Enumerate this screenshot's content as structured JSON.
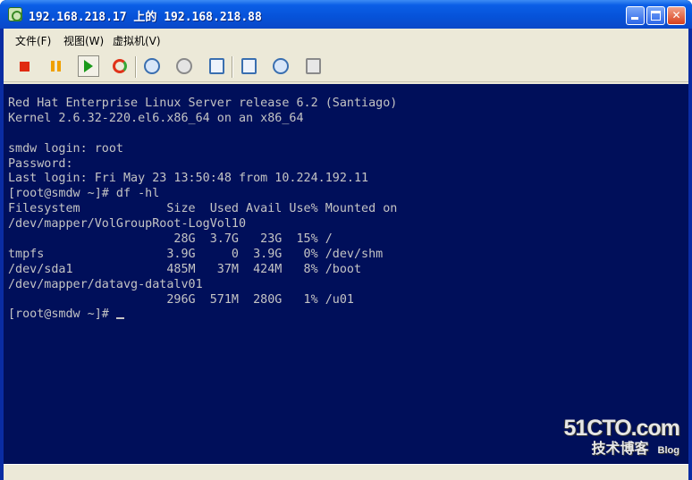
{
  "window": {
    "title": "192.168.218.17 上的 192.168.218.88"
  },
  "menu": {
    "items": [
      "文件(F)",
      "视图(W)",
      "虚拟机(V)"
    ]
  },
  "toolbar": {
    "icons": [
      "stop-icon",
      "pause-icon",
      "play-icon",
      "reset-icon",
      "snapshot-icon",
      "revert-snapshot-icon",
      "snapshot-manager-icon",
      "edit-settings-icon",
      "vm-tools-icon",
      "console-options-icon"
    ]
  },
  "console": {
    "lines": [
      "Red Hat Enterprise Linux Server release 6.2 (Santiago)",
      "Kernel 2.6.32-220.el6.x86_64 on an x86_64",
      "",
      "smdw login: root",
      "Password:",
      "Last login: Fri May 23 13:50:48 from 10.224.192.11",
      "[root@smdw ~]# df -hl",
      "Filesystem            Size  Used Avail Use% Mounted on",
      "/dev/mapper/VolGroupRoot-LogVol10",
      "                       28G  3.7G   23G  15% /",
      "tmpfs                 3.9G     0  3.9G   0% /dev/shm",
      "/dev/sda1             485M   37M  424M   8% /boot",
      "/dev/mapper/datavg-datalv01",
      "                      296G  571M  280G   1% /u01"
    ],
    "prompt": "[root@smdw ~]# "
  },
  "watermark": {
    "logo": "51CTO.com",
    "sub": "技术博客",
    "blog": "Blog"
  },
  "colors": {
    "console_bg": "#000f5a",
    "console_text": "#c4c4c4",
    "titlebar": "#0652d8"
  }
}
